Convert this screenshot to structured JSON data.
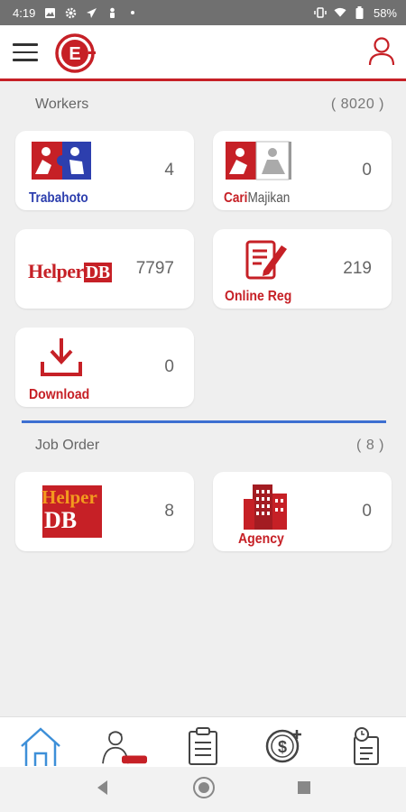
{
  "status_bar": {
    "time": "4:19",
    "battery": "58%"
  },
  "app_bar": {
    "logo_letter": "E"
  },
  "workers": {
    "title": "Workers",
    "count": "( 8020 )",
    "cards": [
      {
        "name": "Trabahoto",
        "count": "4"
      },
      {
        "name_prefix": "Cari",
        "name_suffix": "Majikan",
        "count": "0"
      },
      {
        "name_a": "Helper",
        "name_b": "DB",
        "count": "7797"
      },
      {
        "name": "Online Reg",
        "count": "219"
      },
      {
        "name": "Download",
        "count": "0"
      }
    ]
  },
  "job_order": {
    "title": "Job Order",
    "count": "( 8 )",
    "cards": [
      {
        "name_a": "Helper",
        "name_b": "DB",
        "count": "8"
      },
      {
        "name": "Agency",
        "count": "0"
      }
    ]
  },
  "colors": {
    "brand_red": "#c62026",
    "accent_blue": "#3d6fd1",
    "puzzle_blue": "#2d3fae"
  }
}
